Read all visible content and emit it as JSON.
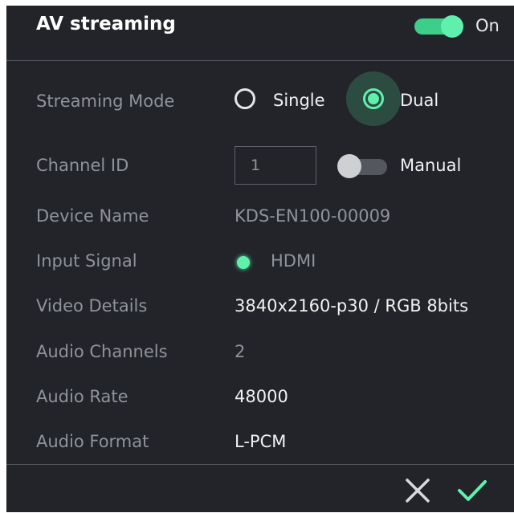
{
  "header": {
    "title": "AV streaming",
    "toggle_state": "On"
  },
  "rows": {
    "streaming_mode": {
      "label": "Streaming Mode",
      "options": [
        {
          "label": "Single",
          "selected": false
        },
        {
          "label": "Dual",
          "selected": true
        }
      ]
    },
    "channel_id": {
      "label": "Channel ID",
      "value": "1",
      "manual_label": "Manual",
      "manual_enabled": false
    },
    "device_name": {
      "label": "Device Name",
      "value": "KDS-EN100-00009"
    },
    "input_signal": {
      "label": "Input Signal",
      "value": "HDMI"
    },
    "video_details": {
      "label": "Video Details",
      "value": "3840x2160-p30 / RGB 8bits"
    },
    "audio_channels": {
      "label": "Audio Channels",
      "value": "2"
    },
    "audio_rate": {
      "label": "Audio Rate",
      "value": "48000"
    },
    "audio_format": {
      "label": "Audio Format",
      "value": "L-PCM"
    }
  },
  "footer": {
    "cancel_icon": "close-icon",
    "confirm_icon": "check-icon"
  },
  "colors": {
    "panel_bg": "#222429",
    "accent": "#5ff0ad",
    "label": "#8f939a",
    "value": "#f1f1f2"
  }
}
